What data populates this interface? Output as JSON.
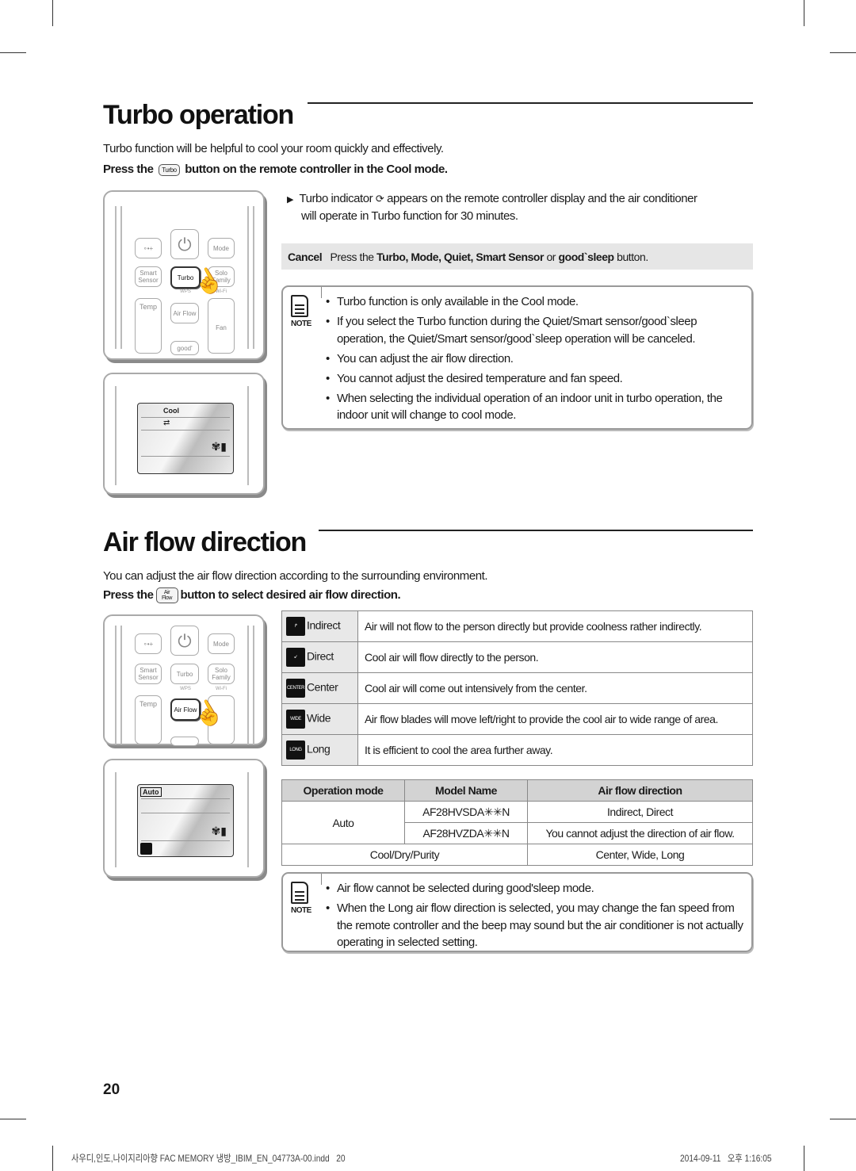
{
  "turbo": {
    "title": "Turbo operation",
    "intro": "Turbo function will be helpful to cool your room quickly and effectively.",
    "press_prefix": "Press the",
    "press_key": "Turbo",
    "press_suffix": "button on the remote controller in the Cool mode.",
    "indicator_line1_a": "Turbo indicator",
    "indicator_line1_b": "appears on the remote controller display and the air conditioner",
    "indicator_line2": "will operate in Turbo function for 30 minutes.",
    "cancel": {
      "label": "Cancel",
      "pre": "Press the",
      "buttons": "Turbo, Mode, Quiet, Smart Sensor",
      "or": "or",
      "last": "good`sleep",
      "post": "button."
    },
    "note_label": "NOTE",
    "notes": [
      "Turbo function is only available in the Cool mode.",
      "If you select the Turbo function during the Quiet/Smart sensor/good`sleep operation, the Quiet/Smart sensor/good`sleep operation will be canceled.",
      "You can adjust the air flow direction.",
      "You cannot adjust the desired temperature and fan speed.",
      "When selecting the individual operation of an indoor unit in turbo operation, the indoor unit will change to cool mode."
    ],
    "display_mode": "Cool"
  },
  "remote": {
    "mode": "Mode",
    "smart": "Smart Sensor",
    "turbo": "Turbo",
    "solo": "Solo Family",
    "wps": "WPS",
    "wifi": "Wi-Fi",
    "airflow": "Air Flow",
    "temp": "Temp",
    "fan": "Fan",
    "good": "good'"
  },
  "airflow": {
    "title": "Air flow direction",
    "intro": "You can adjust the air flow direction according to the surrounding environment.",
    "press_prefix": "Press the",
    "press_key": "Air Flow",
    "press_suffix": "button to select desired air flow direction.",
    "display_mode": "Auto",
    "modes": [
      {
        "name": "Indirect",
        "icon": "indirect-icon",
        "desc": "Air will not flow to the person directly but provide coolness rather indirectly."
      },
      {
        "name": "Direct",
        "icon": "direct-icon",
        "desc": "Cool air will flow directly to the person."
      },
      {
        "name": "Center",
        "icon": "center-icon",
        "icon_text": "CENTER",
        "desc": "Cool air will come out intensively from the center."
      },
      {
        "name": "Wide",
        "icon": "wide-icon",
        "icon_text": "WIDE",
        "desc": "Air flow blades will move left/right to provide the cool air to wide range of area."
      },
      {
        "name": "Long",
        "icon": "long-icon",
        "icon_text": "LONG",
        "desc": "It is efficient to cool the area further away."
      }
    ],
    "table": {
      "headers": [
        "Operation mode",
        "Model Name",
        "Air flow direction"
      ],
      "auto": "Auto",
      "rows": [
        {
          "model": "AF28HVSDA✳✳N",
          "direction": "Indirect, Direct"
        },
        {
          "model": "AF28HVZDA✳✳N",
          "direction": "You cannot adjust the direction of air flow."
        }
      ],
      "last": {
        "mode": "Cool/Dry/Purity",
        "direction": "Center, Wide, Long"
      }
    },
    "note_label": "NOTE",
    "notes": [
      "Air flow cannot be selected during good'sleep mode.",
      "When the Long air flow direction is selected, you may change the fan speed from the remote controller and the beep may sound but the air conditioner is not actually operating in selected setting."
    ]
  },
  "page_number": "20",
  "footer": {
    "file": "사우디,인도,나이지리아향 FAC MEMORY 냉방_IBIM_EN_04773A-00.indd   20",
    "date": "2014-09-11   오후 1:16:05"
  }
}
